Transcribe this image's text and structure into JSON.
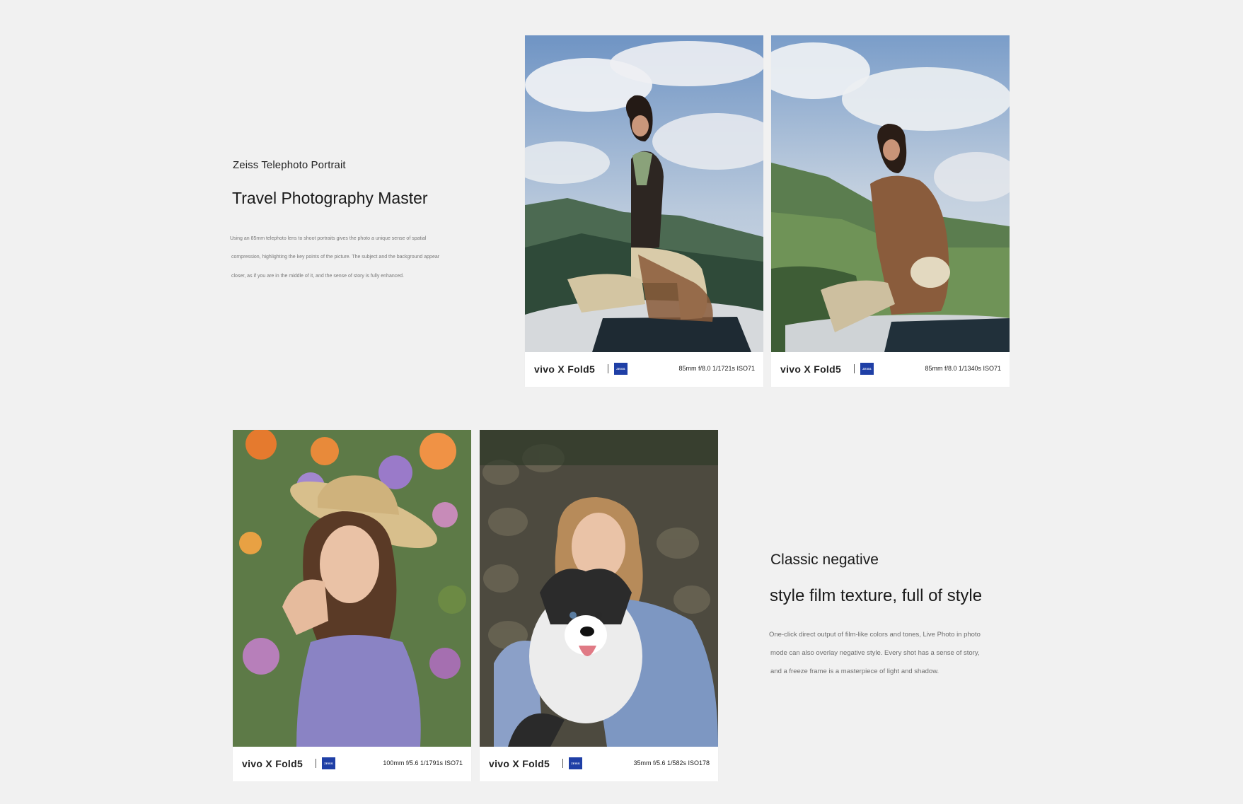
{
  "section_one": {
    "eyebrow": "Zeiss Telephoto Portrait",
    "headline": "Travel Photography Master",
    "body_lines": [
      "Using an 85mm telephoto lens to shoot portraits gives the photo a unique sense of spatial",
      "compression, highlighting the key points of the picture. The subject and the background appear",
      "closer, as if you are in the middle of it, and the sense of story is fully enhanced."
    ]
  },
  "section_two": {
    "headline_line1": "Classic negative",
    "headline_line2": "style film texture, full of style",
    "body_lines": [
      "One-click direct output of film-like colors and tones, Live Photo in photo",
      "mode can also overlay negative style. Every shot has a sense of story,",
      "and a freeze frame is a masterpiece of light and shadow."
    ]
  },
  "photos": [
    {
      "brand": "vivo X Fold5",
      "badge": "ZEISS",
      "exif": "85mm  f/8.0  1/1721s  ISO71",
      "subject_icon": "woman-on-car-roof-image"
    },
    {
      "brand": "vivo X Fold5",
      "badge": "ZEISS",
      "exif": "85mm  f/8.0  1/1340s  ISO71",
      "subject_icon": "woman-in-jacket-image"
    },
    {
      "brand": "vivo X Fold5",
      "badge": "ZEISS",
      "exif": "100mm  f/5.6  1/1791s  ISO71",
      "subject_icon": "woman-with-straw-hat-image"
    },
    {
      "brand": "vivo X Fold5",
      "badge": "ZEISS",
      "exif": "35mm  f/5.6  1/582s  ISO178",
      "subject_icon": "woman-with-dog-image"
    }
  ],
  "colors": {
    "page_background": "#f1f1f1",
    "zeiss_blue": "#1f3fa6",
    "caption_background": "#ffffff"
  }
}
